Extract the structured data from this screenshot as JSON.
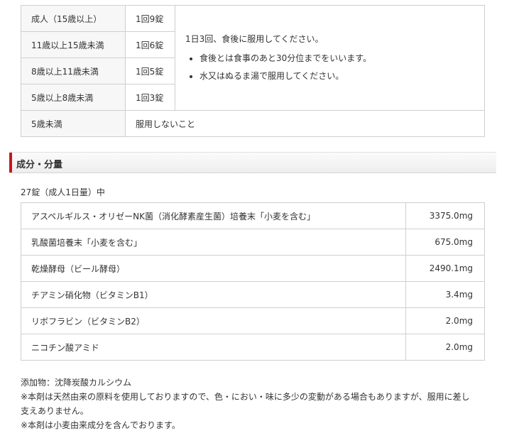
{
  "dosage": {
    "rows": [
      {
        "age": "成人（15歳以上）",
        "amount": "1回9錠"
      },
      {
        "age": "11歳以上15歳未満",
        "amount": "1回6錠"
      },
      {
        "age": "8歳以上11歳未満",
        "amount": "1回5錠"
      },
      {
        "age": "5歳以上8歳未満",
        "amount": "1回3錠"
      }
    ],
    "note": "1日3回、食後に服用してください。",
    "note_bullets": [
      "食後とは食事のあと30分位までをいいます。",
      "水又はぬるま湯で服用してください。"
    ],
    "under5": {
      "age": "5歳未満",
      "text": "服用しないこと"
    }
  },
  "section": {
    "title": "成分・分量"
  },
  "ingredients": {
    "basis": "27錠（成人1日量）中",
    "rows": [
      {
        "name": "アスペルギルス・オリゼーNK菌（消化酵素産生菌）培養末「小麦を含む」",
        "qty": "3375.0mg"
      },
      {
        "name": "乳酸菌培養末「小麦を含む」",
        "qty": "675.0mg"
      },
      {
        "name": "乾燥酵母（ビール酵母）",
        "qty": "2490.1mg"
      },
      {
        "name": "チアミン硝化物（ビタミンB1）",
        "qty": "3.4mg"
      },
      {
        "name": "リボフラビン（ビタミンB2）",
        "qty": "2.0mg"
      },
      {
        "name": "ニコチン酸アミド",
        "qty": "2.0mg"
      }
    ]
  },
  "notes": {
    "additive": "添加物：沈降炭酸カルシウム",
    "note1": "※本剤は天然由来の原料を使用しておりますので、色・におい・味に多少の変動がある場合もありますが、服用に差し支えありません。",
    "note2": "※本剤は小麦由来成分を含んでおります。"
  }
}
